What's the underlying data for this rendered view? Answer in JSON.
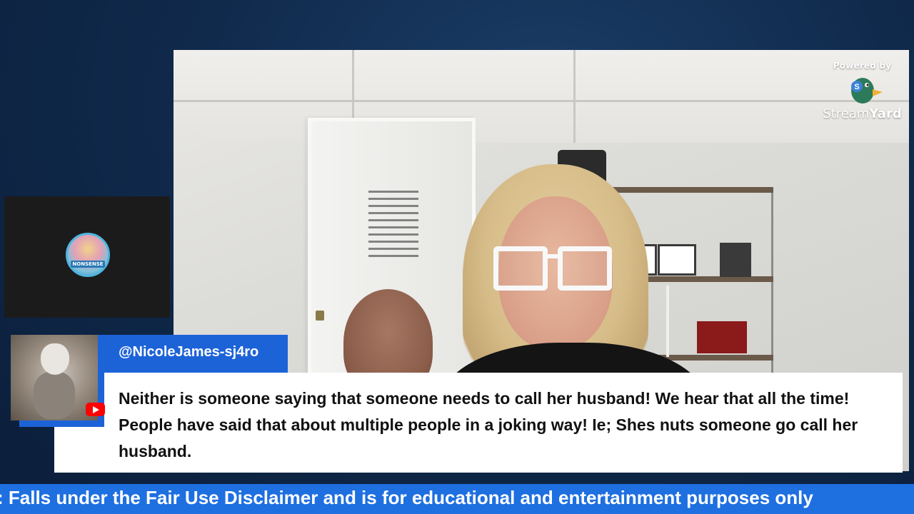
{
  "branding": {
    "powered_by": "Powered by",
    "brand_part1": "Stream",
    "brand_part2": "Yard",
    "icon": "streamyard-duck-icon"
  },
  "side_participant": {
    "avatar_icon": "guest-avatar",
    "banner_text": "NONSENSE"
  },
  "comment": {
    "username": "@NicoleJames-sj4ro",
    "text": "Neither is someone saying that someone needs to call her husband! We hear that all the time! People have said that about multiple people in a joking way! Ie; Shes nuts someone go call her husband.",
    "platform_icon": "youtube-icon",
    "accent_color": "#1d63d8"
  },
  "ticker": {
    "text": ": Falls under the Fair Use Disclaimer and is for educational and entertainment purposes only",
    "color": "#1e6fe0"
  }
}
